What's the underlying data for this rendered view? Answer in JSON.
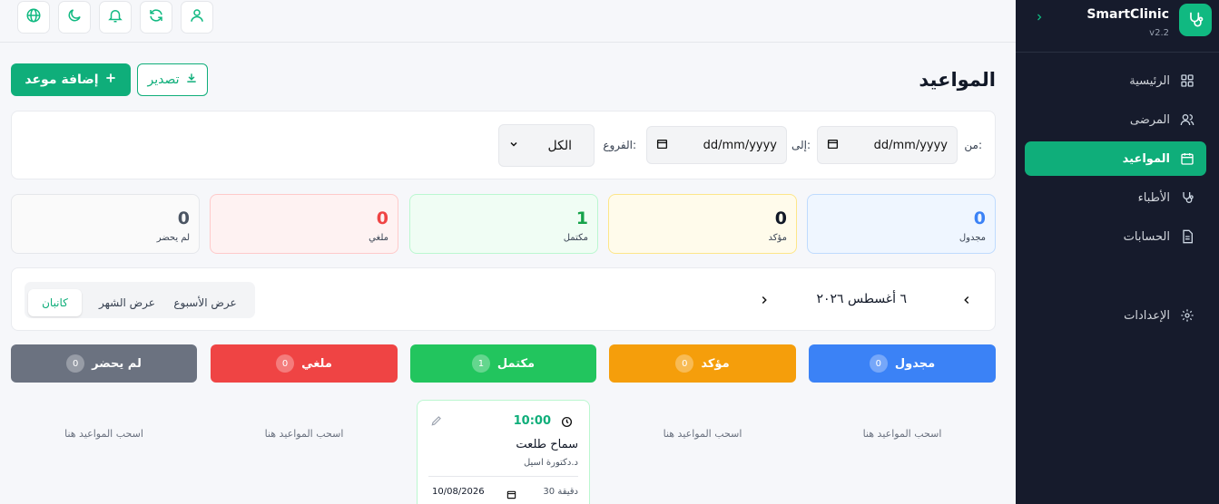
{
  "brand": {
    "name": "SmartClinic",
    "version": "v2.2"
  },
  "sidebar": {
    "items": [
      {
        "label": "الرئيسية",
        "icon": "dashboard-icon"
      },
      {
        "label": "المرضى",
        "icon": "users-icon"
      },
      {
        "label": "المواعيد",
        "icon": "calendar-icon",
        "active": true
      },
      {
        "label": "الأطباء",
        "icon": "stethoscope-icon"
      },
      {
        "label": "الحسابات",
        "icon": "file-icon"
      }
    ],
    "settings": "الإعدادات"
  },
  "topbar": {
    "icons": [
      "user-icon",
      "refresh-icon",
      "bell-icon",
      "moon-icon",
      "globe-icon"
    ]
  },
  "page": {
    "title": "المواعيد",
    "add_label": "إضافة موعد",
    "export_label": "تصدير"
  },
  "filters": {
    "from_label": "من:",
    "to_label": "إلى:",
    "branch_label": "الفروع:",
    "from_placeholder": "dd/mm/yyyy",
    "to_placeholder": "dd/mm/yyyy",
    "branch_value": "الكل"
  },
  "stats": [
    {
      "label": "مجدول",
      "value": "0",
      "color": "#3b82f6"
    },
    {
      "label": "مؤكد",
      "value": "0",
      "color": "#111827"
    },
    {
      "label": "مكتمل",
      "value": "1",
      "color": "#16a34a"
    },
    {
      "label": "ملغي",
      "value": "0",
      "color": "#ef4444"
    },
    {
      "label": "لم يحضر",
      "value": "0",
      "color": "#4b5563"
    }
  ],
  "calendar": {
    "date": "٦ أغسطس ٢٠٢٦",
    "views": [
      "عرض الأسبوع",
      "عرض الشهر",
      "كانبان"
    ],
    "active_view": "كانبان"
  },
  "columns": [
    {
      "label": "مجدول",
      "count": "0",
      "color": "#3b82f6"
    },
    {
      "label": "مؤكد",
      "count": "0",
      "color": "#f59e0b"
    },
    {
      "label": "مكتمل",
      "count": "1",
      "color": "#22c55e"
    },
    {
      "label": "ملغي",
      "count": "0",
      "color": "#ef4444"
    },
    {
      "label": "لم يحضر",
      "count": "0",
      "color": "#6b7280"
    }
  ],
  "drop_hint": "اسحب المواعيد هنا",
  "appointment": {
    "time": "10:00",
    "patient": "سماح طلعت",
    "doctor": "د.دكتورة اسيل",
    "duration": "30 دقيقة",
    "date": "10/08/2026"
  }
}
